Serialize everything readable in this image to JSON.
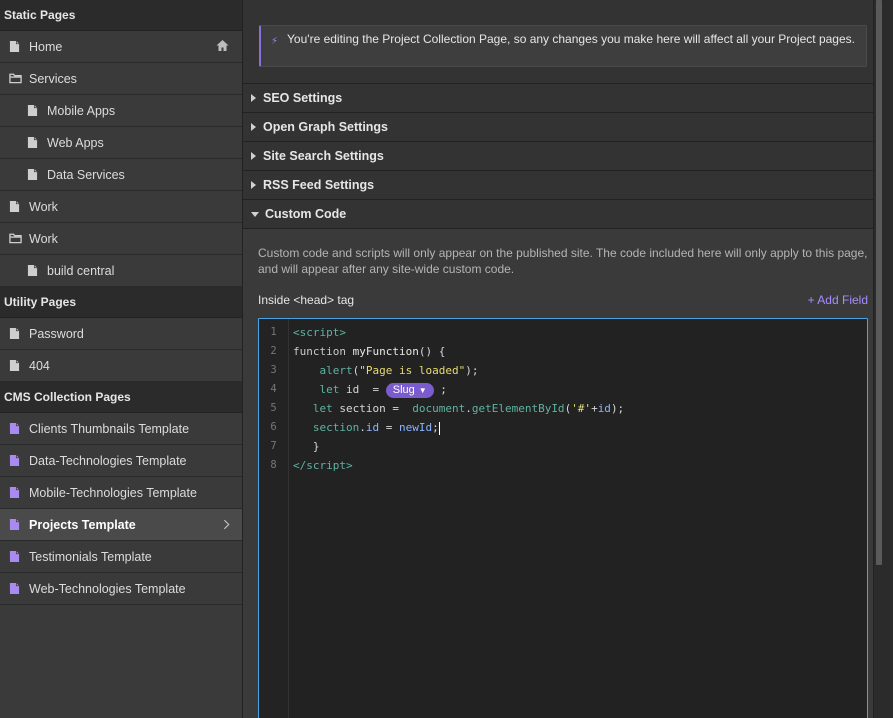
{
  "sidebar": {
    "sections": [
      {
        "title": "Static Pages",
        "items": [
          {
            "label": "Home",
            "icon": "page-icon",
            "level": 0,
            "right": "home-icon"
          },
          {
            "label": "Services",
            "icon": "folder-icon",
            "level": 0
          },
          {
            "label": "Mobile Apps",
            "icon": "page-icon",
            "level": 1
          },
          {
            "label": "Web Apps",
            "icon": "page-icon",
            "level": 1
          },
          {
            "label": "Data Services",
            "icon": "page-icon",
            "level": 1
          },
          {
            "label": "Work",
            "icon": "page-icon",
            "level": 0
          },
          {
            "label": "Work",
            "icon": "folder-icon",
            "level": 0
          },
          {
            "label": "build central",
            "icon": "page-icon",
            "level": 1
          }
        ]
      },
      {
        "title": "Utility Pages",
        "items": [
          {
            "label": "Password",
            "icon": "page-icon",
            "level": 0
          },
          {
            "label": "404",
            "icon": "page-icon",
            "level": 0
          }
        ]
      },
      {
        "title": "CMS Collection Pages",
        "items": [
          {
            "label": "Clients Thumbnails Template",
            "icon": "cms-page-icon",
            "level": 0
          },
          {
            "label": "Data-Technologies Template",
            "icon": "cms-page-icon",
            "level": 0
          },
          {
            "label": "Mobile-Technologies Template",
            "icon": "cms-page-icon",
            "level": 0
          },
          {
            "label": "Projects Template",
            "icon": "cms-page-icon",
            "level": 0,
            "active": true,
            "right": "chevron-right-icon"
          },
          {
            "label": "Testimonials Template",
            "icon": "cms-page-icon",
            "level": 0
          },
          {
            "label": "Web-Technologies Template",
            "icon": "cms-page-icon",
            "level": 0
          }
        ]
      }
    ]
  },
  "main": {
    "notice": "You're editing the Project Collection Page, so any changes you make here will affect all your Project pages.",
    "accordions": [
      {
        "label": "SEO Settings",
        "open": false
      },
      {
        "label": "Open Graph Settings",
        "open": false
      },
      {
        "label": "Site Search Settings",
        "open": false
      },
      {
        "label": "RSS Feed Settings",
        "open": false
      },
      {
        "label": "Custom Code",
        "open": true
      }
    ],
    "custom_code": {
      "description": "Custom code and scripts will only appear on the published site. The code included here will only apply to this page, and will appear after any site-wide custom code.",
      "field_label": "Inside <head> tag",
      "add_field": "+ Add Field",
      "line_numbers": [
        "1",
        "2",
        "3",
        "4",
        "5",
        "6",
        "7",
        "8"
      ],
      "slug_label": "Slug"
    }
  },
  "colors": {
    "accent": "#7a5ccf",
    "link": "#a88bff",
    "editor_border": "#4aa3df"
  }
}
